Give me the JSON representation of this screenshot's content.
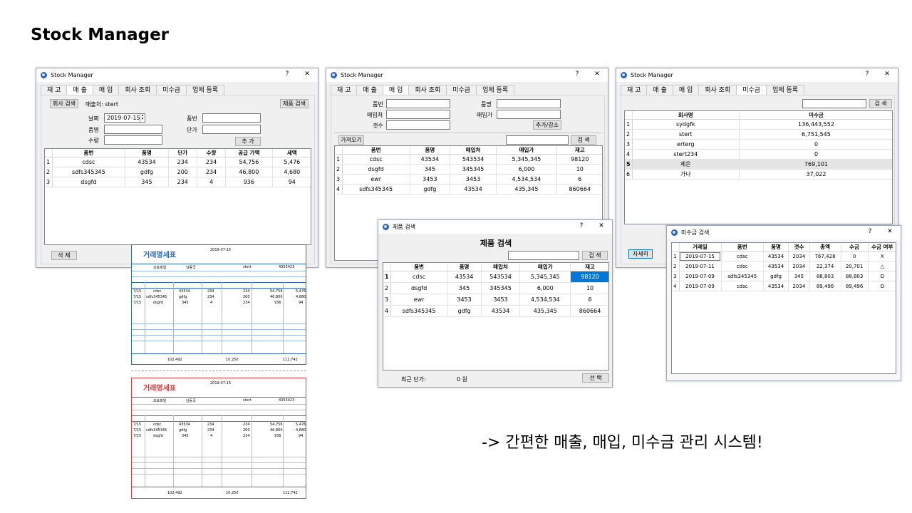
{
  "slide": {
    "title": "Stock Manager",
    "caption": "-> 간편한 매출, 매입, 미수금 관리 시스템!"
  },
  "colors": {
    "selection": "#0078d7",
    "invoice_blue": "#2e66c2",
    "invoice_red": "#e23b3b"
  },
  "win1": {
    "title": "Stock Manager",
    "help": "?",
    "close": "✕",
    "tabs": [
      "재 고",
      "매 출",
      "매 입",
      "회사 조회",
      "미수금",
      "업체 등록"
    ],
    "active_tab": "매 출",
    "company_search_btn": "회사 검색",
    "customer_label": "매출처: stert",
    "product_search_btn": "제품 검색",
    "date_label": "날짜",
    "date_value": "2019-07-15",
    "code_label": "품번",
    "name_label": "품명",
    "price_label": "단가",
    "qty_label": "수량",
    "add_btn": "추 가",
    "delete_btn": "삭 제",
    "columns": [
      "품번",
      "품명",
      "단가",
      "수량",
      "공급 가액",
      "세액"
    ],
    "rows": [
      [
        "1",
        "cdsc",
        "43534",
        "234",
        "234",
        "54,756",
        "5,476"
      ],
      [
        "2",
        "sdfs345345",
        "gdfg",
        "200",
        "234",
        "46,800",
        "4,680"
      ],
      [
        "3",
        "dsgfd",
        "345",
        "234",
        "4",
        "936",
        "94"
      ]
    ]
  },
  "win2": {
    "title": "Stock Manager",
    "help": "?",
    "close": "✕",
    "tabs": [
      "재 고",
      "매 출",
      "매 입",
      "회사 조회",
      "미수금",
      "업체 등록"
    ],
    "active_tab": "매 입",
    "code_label": "품번",
    "name_label": "품명",
    "supplier_label": "매입처",
    "cost_label": "매입가",
    "qty_label": "갯수",
    "addsub_btn": "추가/감소",
    "load_btn": "가져오기",
    "search_btn": "검 색",
    "columns": [
      "품번",
      "품명",
      "매입처",
      "매입가",
      "재고"
    ],
    "rows": [
      [
        "1",
        "cdsc",
        "43534",
        "543534",
        "5,345,345",
        "98120"
      ],
      [
        "2",
        "dsgfd",
        "345",
        "345345",
        "6,000",
        "10"
      ],
      [
        "3",
        "ewr",
        "3453",
        "3453",
        "4,534,534",
        "6"
      ],
      [
        "4",
        "sdfs345345",
        "gdfg",
        "43534",
        "435,345",
        "860664"
      ]
    ]
  },
  "win3": {
    "title": "Stock Manager",
    "help": "?",
    "close": "✕",
    "tabs": [
      "재 고",
      "매 출",
      "매 입",
      "회사 조회",
      "미수금",
      "업체 등록"
    ],
    "active_tab": "미수금",
    "search_btn": "검 색",
    "detail_btn": "자세히",
    "columns": [
      "회사명",
      "미수금"
    ],
    "rows": [
      [
        "1",
        "sydgfk",
        "136,443,552"
      ],
      [
        "2",
        "stert",
        "6,751,545"
      ],
      [
        "3",
        "erterg",
        "0"
      ],
      [
        "4",
        "stert234",
        "0"
      ],
      [
        "5",
        "제은",
        "769,101"
      ],
      [
        "6",
        "가나",
        "37,022"
      ]
    ]
  },
  "product_dialog": {
    "title": "제품 검색",
    "help": "?",
    "close": "✕",
    "heading": "제품 검색",
    "search_btn": "검 색",
    "columns": [
      "품번",
      "품명",
      "매입처",
      "매입가",
      "재고"
    ],
    "rows": [
      [
        "1",
        "cdsc",
        "43534",
        "543534",
        "5,345,345",
        "98120"
      ],
      [
        "2",
        "dsgfd",
        "345",
        "345345",
        "6,000",
        "10"
      ],
      [
        "3",
        "ewr",
        "3453",
        "3453",
        "4,534,534",
        "6"
      ],
      [
        "4",
        "sdfs345345",
        "gdfg",
        "43534",
        "435,345",
        "860664"
      ]
    ],
    "recent_price_label": "최근 단가:",
    "recent_price_value": "0 원",
    "select_btn": "선 택"
  },
  "receivable_dialog": {
    "title": "미수금 검색",
    "help": "?",
    "close": "✕",
    "columns": [
      "거래일",
      "품번",
      "품명",
      "갯수",
      "총액",
      "수금",
      "수금 여부"
    ],
    "rows": [
      [
        "1",
        "2019-07-15",
        "cdsc",
        "43534",
        "2034",
        "767,428",
        "0",
        "X"
      ],
      [
        "2",
        "2019-07-11",
        "cdsc",
        "43534",
        "2034",
        "22,374",
        "20,701",
        "△"
      ],
      [
        "3",
        "2019-07-09",
        "sdfs345345",
        "gdfg",
        "345",
        "88,803",
        "88,803",
        "O"
      ],
      [
        "4",
        "2019-07-09",
        "cdsc",
        "43534",
        "2034",
        "89,496",
        "89,496",
        "O"
      ]
    ]
  },
  "invoice": {
    "title": "거래명세표",
    "date": "2019-07-15",
    "supplier": "오토파일",
    "owner": "남동국",
    "buyer": "stert",
    "buyer_no": "4353423",
    "rows": [
      [
        "7/15",
        "cdsc",
        "43534",
        "234",
        "234",
        "54,756",
        "5,476"
      ],
      [
        "7/15",
        "sdfs345345",
        "gdfg",
        "234",
        "200",
        "46,800",
        "4,680"
      ],
      [
        "7/15",
        "dsgfd",
        "345",
        "4",
        "234",
        "936",
        "94"
      ]
    ],
    "supply_total": "102,492",
    "tax_total": "10,250",
    "grand_total": "112,742"
  }
}
